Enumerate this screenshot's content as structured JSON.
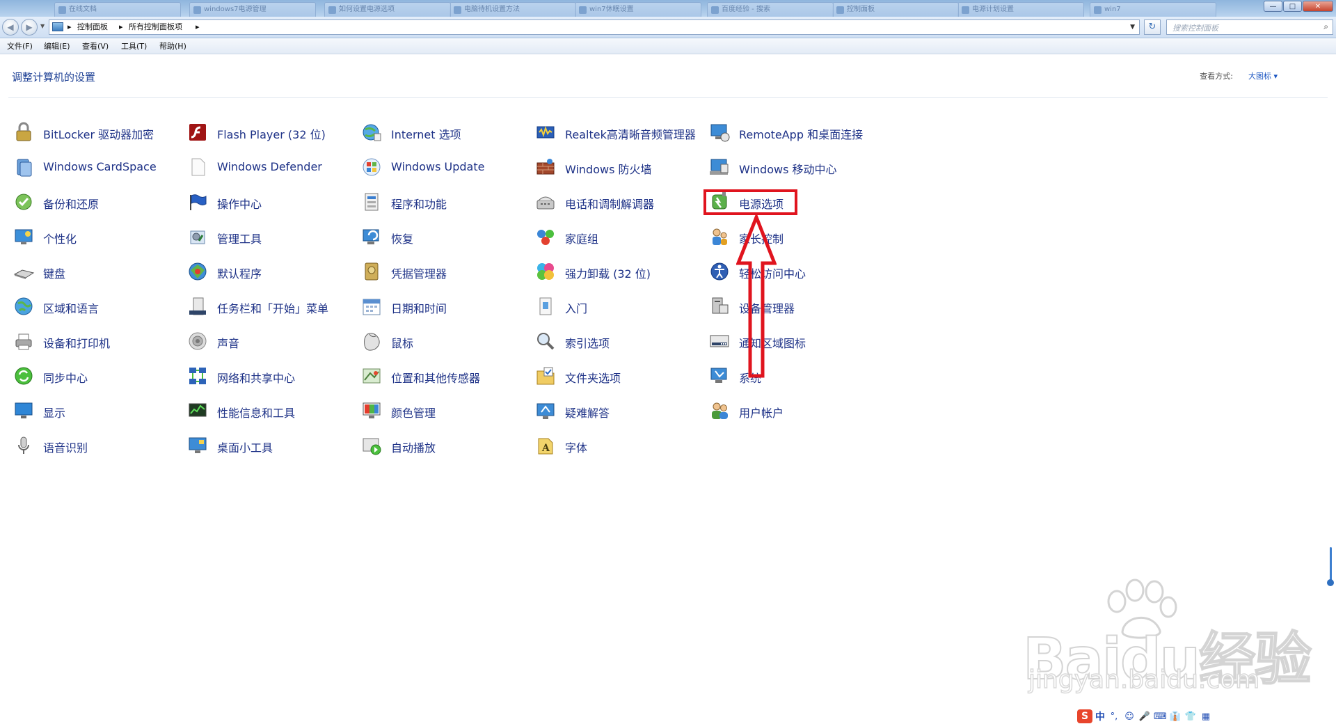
{
  "window": {
    "tabs": [
      {
        "label": "在线文档"
      },
      {
        "label": "windows7电源管理"
      },
      {
        "label": "如何设置电源选项"
      },
      {
        "label": "电脑待机设置方法"
      },
      {
        "label": "win7休眠设置"
      },
      {
        "label": "百度经验 - 搜索"
      },
      {
        "label": "控制面板"
      },
      {
        "label": "电源计划设置"
      },
      {
        "label": "win7"
      }
    ],
    "minimize": "—",
    "maximize": "□",
    "close": "✕"
  },
  "address": {
    "crumbs": [
      "控制面板",
      "所有控制面板项"
    ],
    "separator": "▸",
    "refresh": "↻",
    "search_placeholder": "搜索控制面板",
    "search_icon": "⌕"
  },
  "menu": [
    "文件(F)",
    "编辑(E)",
    "查看(V)",
    "工具(T)",
    "帮助(H)"
  ],
  "page": {
    "title": "调整计算机的设置",
    "view_by_label": "查看方式:",
    "view_by_value": "大图标 ▾"
  },
  "items": [
    {
      "label": "BitLocker 驱动器加密",
      "icon": "bitlocker-icon"
    },
    {
      "label": "Windows CardSpace",
      "icon": "cardspace-icon"
    },
    {
      "label": "备份和还原",
      "icon": "backup-icon"
    },
    {
      "label": "个性化",
      "icon": "personalization-icon"
    },
    {
      "label": "键盘",
      "icon": "keyboard-icon"
    },
    {
      "label": "区域和语言",
      "icon": "globe-icon"
    },
    {
      "label": "设备和打印机",
      "icon": "printer-icon"
    },
    {
      "label": "同步中心",
      "icon": "sync-icon"
    },
    {
      "label": "显示",
      "icon": "display-icon"
    },
    {
      "label": "语音识别",
      "icon": "microphone-icon"
    },
    {
      "label": "Flash Player (32 位)",
      "icon": "flash-icon"
    },
    {
      "label": "Windows Defender",
      "icon": "defender-icon"
    },
    {
      "label": "操作中心",
      "icon": "flag-icon"
    },
    {
      "label": "管理工具",
      "icon": "admin-tools-icon"
    },
    {
      "label": "默认程序",
      "icon": "default-programs-icon"
    },
    {
      "label": "任务栏和「开始」菜单",
      "icon": "taskbar-icon"
    },
    {
      "label": "声音",
      "icon": "speaker-icon"
    },
    {
      "label": "网络和共享中心",
      "icon": "network-icon"
    },
    {
      "label": "性能信息和工具",
      "icon": "performance-icon"
    },
    {
      "label": "桌面小工具",
      "icon": "gadgets-icon"
    },
    {
      "label": "Internet 选项",
      "icon": "internet-icon"
    },
    {
      "label": "Windows Update",
      "icon": "windows-update-icon"
    },
    {
      "label": "程序和功能",
      "icon": "programs-icon"
    },
    {
      "label": "恢复",
      "icon": "recovery-icon"
    },
    {
      "label": "凭据管理器",
      "icon": "credential-icon"
    },
    {
      "label": "日期和时间",
      "icon": "calendar-icon"
    },
    {
      "label": "鼠标",
      "icon": "mouse-icon"
    },
    {
      "label": "位置和其他传感器",
      "icon": "sensor-icon"
    },
    {
      "label": "颜色管理",
      "icon": "color-icon"
    },
    {
      "label": "自动播放",
      "icon": "autoplay-icon"
    },
    {
      "label": "Realtek高清晰音频管理器",
      "icon": "audio-manager-icon"
    },
    {
      "label": "Windows 防火墙",
      "icon": "firewall-icon"
    },
    {
      "label": "电话和调制解调器",
      "icon": "phone-icon"
    },
    {
      "label": "家庭组",
      "icon": "homegroup-icon"
    },
    {
      "label": "强力卸载 (32 位)",
      "icon": "uninstall-icon"
    },
    {
      "label": "入门",
      "icon": "getting-started-icon"
    },
    {
      "label": "索引选项",
      "icon": "index-icon"
    },
    {
      "label": "文件夹选项",
      "icon": "folder-icon"
    },
    {
      "label": "疑难解答",
      "icon": "troubleshoot-icon"
    },
    {
      "label": "字体",
      "icon": "font-icon"
    },
    {
      "label": "RemoteApp 和桌面连接",
      "icon": "remoteapp-icon"
    },
    {
      "label": "Windows 移动中心",
      "icon": "mobility-icon"
    },
    {
      "label": "电源选项",
      "icon": "power-icon"
    },
    {
      "label": "家长控制",
      "icon": "parental-icon"
    },
    {
      "label": "轻松访问中心",
      "icon": "ease-access-icon"
    },
    {
      "label": "设备管理器",
      "icon": "device-manager-icon"
    },
    {
      "label": "通知区域图标",
      "icon": "notification-icon"
    },
    {
      "label": "系统",
      "icon": "system-icon"
    },
    {
      "label": "用户帐户",
      "icon": "user-accounts-icon"
    }
  ],
  "watermark": {
    "text": "Baidu经验",
    "sub": "jingyan.baidu.com"
  },
  "ime": {
    "logo": "S",
    "mode": "中",
    "icons": [
      "°,",
      "☺",
      "🎤",
      "⌨",
      "👔",
      "👕",
      "▦"
    ]
  },
  "colors": {
    "link": "#1e3287",
    "highlight": "#e0141e",
    "title": "#1c3f94"
  }
}
